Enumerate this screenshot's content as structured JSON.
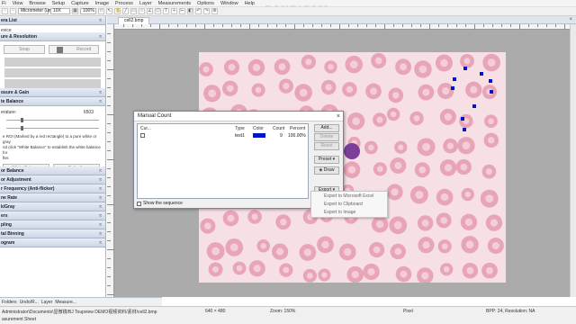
{
  "menu": [
    "Fi",
    "View",
    "Browse",
    "Setup",
    "Capture",
    "Image",
    "Process",
    "Layer",
    "Measurements",
    "Options",
    "Window",
    "Help"
  ],
  "toolbar": {
    "unit_select": "Micrometer (um)",
    "magnification": "10X",
    "zoom": "100%"
  },
  "watermark": "www.BANDICAM.com",
  "sidebar": {
    "sections": {
      "list": "era List",
      "device": "evice",
      "exposure": "ure & Resolution",
      "gain": "osure & Gain",
      "white_balance": "te Balance",
      "color_balance": "or Balance",
      "color_adjustment": "or Adjustment",
      "frequency": "r Frequency (Anti-flicker)",
      "frame_rate": "ne Rate",
      "grayscale": "k/Gray",
      "misc": "ers",
      "sampling": "pling",
      "binning": "tal Binning",
      "histogram": "ogram"
    },
    "snap_button": "Snap",
    "record_button": "Record",
    "temperature_label": "erature:",
    "temperature_value": "6503",
    "wb_hint": "e ROI (Marked by a red rectangle) to a pure white or gray\nnd click \"White Balance\" to establish the white balance for\nfter.",
    "white_balance_button": "White Balance",
    "defaults_button": "Defaults"
  },
  "bottom_tabs": [
    "Folders",
    "Undo/R...",
    "Layer",
    "Measure..."
  ],
  "doc_tab": "cell2.bmp",
  "dialog": {
    "title": "Manual Count",
    "columns": [
      "Cur...",
      "Type",
      "Color",
      "Count",
      "Percent"
    ],
    "rows": [
      {
        "type": "test1",
        "color": "#0015c8",
        "count": "9",
        "percent": "100.00%"
      }
    ],
    "show_sequence": "Show the sequence",
    "buttons": {
      "add": "Add...",
      "delete": "Delete",
      "reset": "Reset",
      "preset": "Preset",
      "draw": "Draw",
      "export": "Export"
    }
  },
  "context_menu": [
    "Export to Microsoft Excel",
    "Export to Clipboard",
    "Export to Image"
  ],
  "status": {
    "path": "Administrator\\Documents\\显微镜/BJ Toupview DEMO视频资料/素材/cell2.bmp",
    "sheet": "asurement Sheet",
    "size": "640 × 480",
    "zoom": "Zoom: 150%",
    "pixel": "Pixel",
    "info": "BPP: 24, Resolution: NA"
  },
  "colors": {
    "marker": "#0015c8",
    "cell": "#e8a5b8",
    "background": "#f6dfe5",
    "wbc": "#7d3d9a"
  }
}
